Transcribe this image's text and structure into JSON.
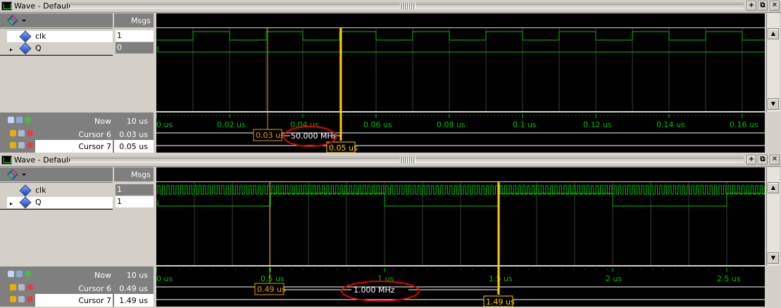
{
  "panels": [
    {
      "title": "Wave - Default",
      "msgs_header": "Msgs",
      "signals": [
        {
          "name": "clk",
          "value": "1"
        },
        {
          "name": "Q",
          "value": "0"
        }
      ],
      "now_label": "Now",
      "now_value": "10 us",
      "cursors": [
        {
          "name": "Cursor 6",
          "value": "0.03 us"
        },
        {
          "name": "Cursor 7",
          "value": "0.05 us"
        }
      ],
      "time_ticks": [
        "0 us",
        "0.02 us",
        "0.04 us",
        "0.06 us",
        "0.08 us",
        "0.1 us",
        "0.12 us",
        "0.14 us",
        "0.16 us"
      ],
      "cursor_a_label": "0.03 us",
      "cursor_b_label": "0.05 us",
      "frequency_label": "50.000 MHz"
    },
    {
      "title": "Wave - Default",
      "msgs_header": "Msgs",
      "signals": [
        {
          "name": "clk",
          "value": "1"
        },
        {
          "name": "Q",
          "value": "1"
        }
      ],
      "now_label": "Now",
      "now_value": "10 us",
      "cursors": [
        {
          "name": "Cursor 6",
          "value": "0.49 us"
        },
        {
          "name": "Cursor 7",
          "value": "1.49 us"
        }
      ],
      "time_ticks": [
        "0 us",
        "0.5 us",
        "1 us",
        "1.5 us",
        "2 us",
        "2.5 us"
      ],
      "cursor_a_label": "0.49 us",
      "cursor_b_label": "1.49 us",
      "frequency_label": "1.000 MHz"
    }
  ],
  "colors": {
    "waveform": "#00c000",
    "cursor_active": "#ffcc00",
    "cursor_inactive": "#e0a000",
    "annotation_ellipse": "#e00000",
    "background": "#000000"
  },
  "icons": [
    "wave-app-icon",
    "wave-toolbar-icon",
    "signal-diamond-icon",
    "lock-icon",
    "wrench-icon",
    "remove-cursor-icon",
    "add-cursor-icon",
    "plus-button-icon",
    "restore-button-icon",
    "close-button-icon"
  ]
}
